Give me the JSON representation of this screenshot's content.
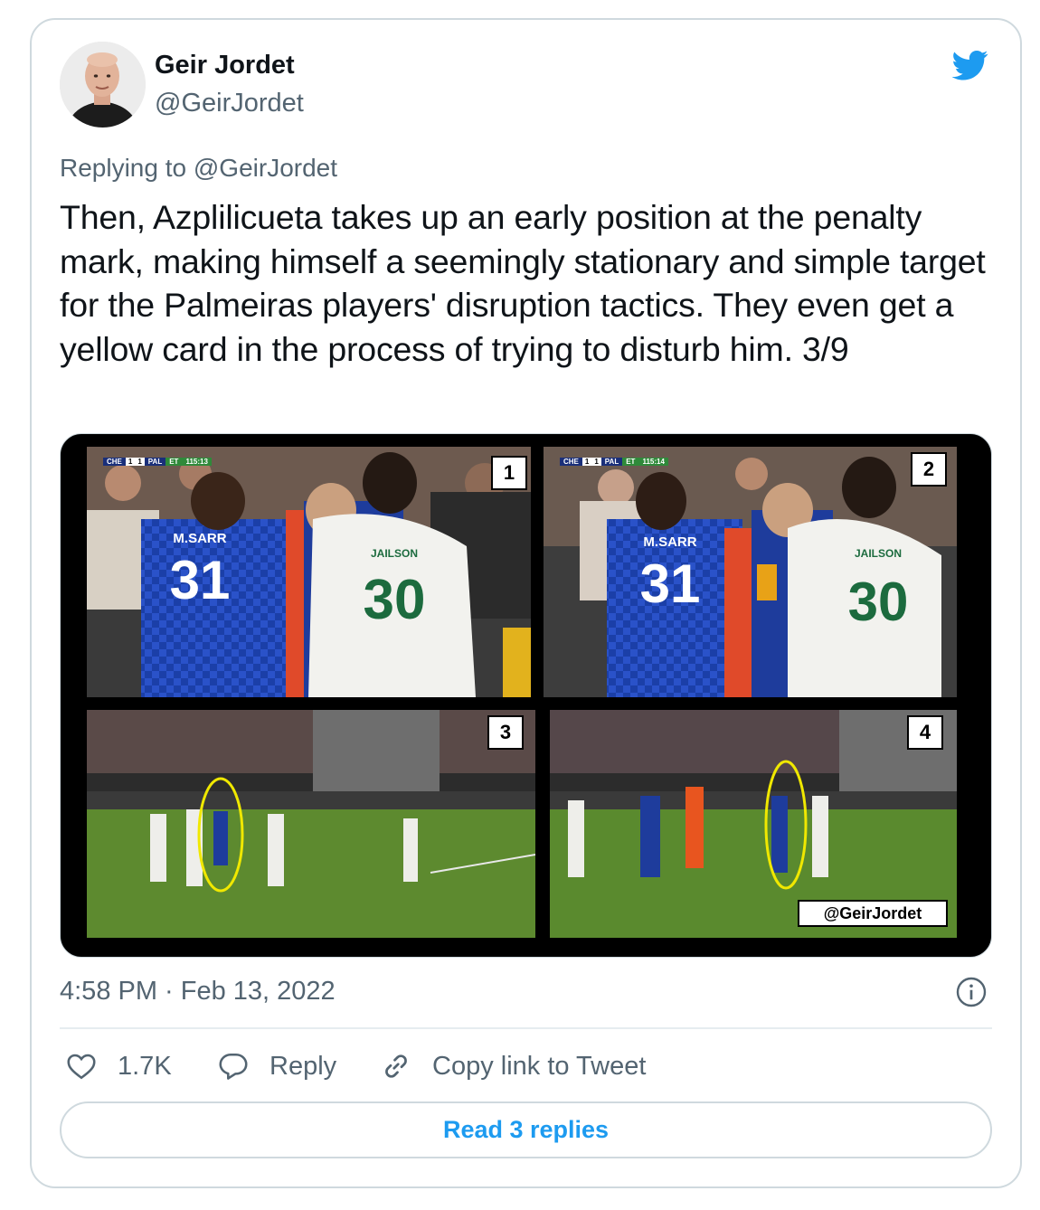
{
  "tweet": {
    "author": {
      "name": "Geir Jordet",
      "handle": "@GeirJordet"
    },
    "reply_prefix": "Replying to ",
    "reply_to": "@GeirJordet",
    "text": "Then, Azplilicueta takes up an early position at the penalty mark, making himself a seemingly stationary and simple target for the Palmeiras players' disruption tactics. They even get a yellow card in the process of trying to disturb him. 3/9",
    "timestamp": "4:58 PM · Feb 13, 2022",
    "media": {
      "panels": [
        "1",
        "2",
        "3",
        "4"
      ],
      "watermark": "@GeirJordet",
      "scorebug_1": {
        "home": "CHE",
        "home_score": "1",
        "away_score": "1",
        "away": "PAL",
        "period": "ET",
        "clock": "115:13"
      },
      "scorebug_2": {
        "home": "CHE",
        "home_score": "1",
        "away_score": "1",
        "away": "PAL",
        "period": "ET",
        "clock": "115:14"
      },
      "jerseys": {
        "sarr_name": "M.SARR",
        "sarr_number": "31",
        "jailson_name": "JAILSON",
        "jailson_number": "30"
      }
    },
    "actions": {
      "like_count": "1.7K",
      "reply_label": "Reply",
      "copy_label": "Copy link to Tweet"
    },
    "read_replies": "Read 3 replies"
  },
  "colors": {
    "brand_blue": "#1d9bf0",
    "secondary_text": "#536471",
    "border": "#cfd9de"
  },
  "icons": [
    "twitter-bird-icon",
    "info-icon",
    "heart-icon",
    "reply-bubble-icon",
    "link-icon"
  ]
}
